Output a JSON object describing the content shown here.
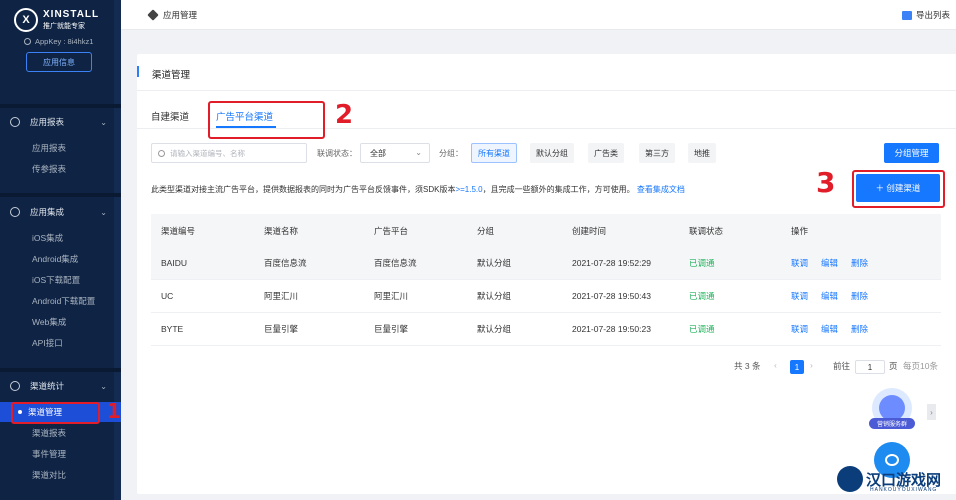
{
  "sidebar": {
    "logo_mark": "X",
    "brand": "XINSTALL",
    "brand_sub": "推广就能专家",
    "appkey": "AppKey : 8i4hkz1",
    "appinfo_button": "应用信息",
    "groups": [
      {
        "label": "应用报表",
        "items": [
          "应用报表",
          "传参报表"
        ]
      },
      {
        "label": "应用集成",
        "items": [
          "iOS集成",
          "Android集成",
          "iOS下载配置",
          "Android下载配置",
          "Web集成",
          "API接口"
        ]
      },
      {
        "label": "渠道统计",
        "items": [
          "渠道管理",
          "渠道报表",
          "事件管理",
          "渠道对比"
        ]
      }
    ],
    "active_item": "渠道管理"
  },
  "topbar": {
    "breadcrumb": "应用管理",
    "export": "导出列表"
  },
  "panel": {
    "title": "渠道管理",
    "tabs": [
      "自建渠道",
      "广告平台渠道"
    ],
    "active_tab": "广告平台渠道",
    "search_placeholder": "请输入渠道编号、名称",
    "status_label": "联调状态：",
    "status_value": "全部",
    "group_label": "分组：",
    "group_chips": [
      "所有渠道",
      "默认分组",
      "广告类",
      "第三方",
      "地推"
    ],
    "group_manage_button": "分组管理",
    "create_button": "＋ 创建渠道",
    "notice_pre": "此类型渠道对接主流广告平台，提供数据报表的同时为广告平台反馈事件，须SDK版本",
    "notice_version": ">=1.5.0",
    "notice_post": "，且完成一些额外的集成工作，方可使用。",
    "notice_link": "查看集成文档"
  },
  "table": {
    "headers": [
      "渠道编号",
      "渠道名称",
      "广告平台",
      "分组",
      "创建时间",
      "联调状态",
      "操作"
    ],
    "rows": [
      {
        "code": "BAIDU",
        "name": "百度信息流",
        "platform": "百度信息流",
        "group": "默认分组",
        "created": "2021-07-28 19:52:29",
        "status": "已调通"
      },
      {
        "code": "UC",
        "name": "阿里汇川",
        "platform": "阿里汇川",
        "group": "默认分组",
        "created": "2021-07-28 19:50:43",
        "status": "已调通"
      },
      {
        "code": "BYTE",
        "name": "巨量引擎",
        "platform": "巨量引擎",
        "group": "默认分组",
        "created": "2021-07-28 19:50:23",
        "status": "已调通"
      }
    ],
    "actions": [
      "联调",
      "编辑",
      "删除"
    ]
  },
  "pagination": {
    "total": "共 3 条",
    "prev": "‹",
    "page": "1",
    "next": "›",
    "goto": "前往",
    "goto_value": "1",
    "page_unit": "页",
    "page_size": "每页10条"
  },
  "annotations": {
    "n1": "1",
    "n2": "2",
    "n3": "3"
  },
  "floating": {
    "tag": "营销服务群",
    "arrow": "›"
  },
  "watermark": {
    "title": "汉口游戏网",
    "sub": "HANKOUYOUXIWANG"
  },
  "colors": {
    "accent": "#1677ff",
    "sidebar_bg": "#0f2444",
    "success": "#22b35c",
    "annotation": "#e11d2a"
  }
}
